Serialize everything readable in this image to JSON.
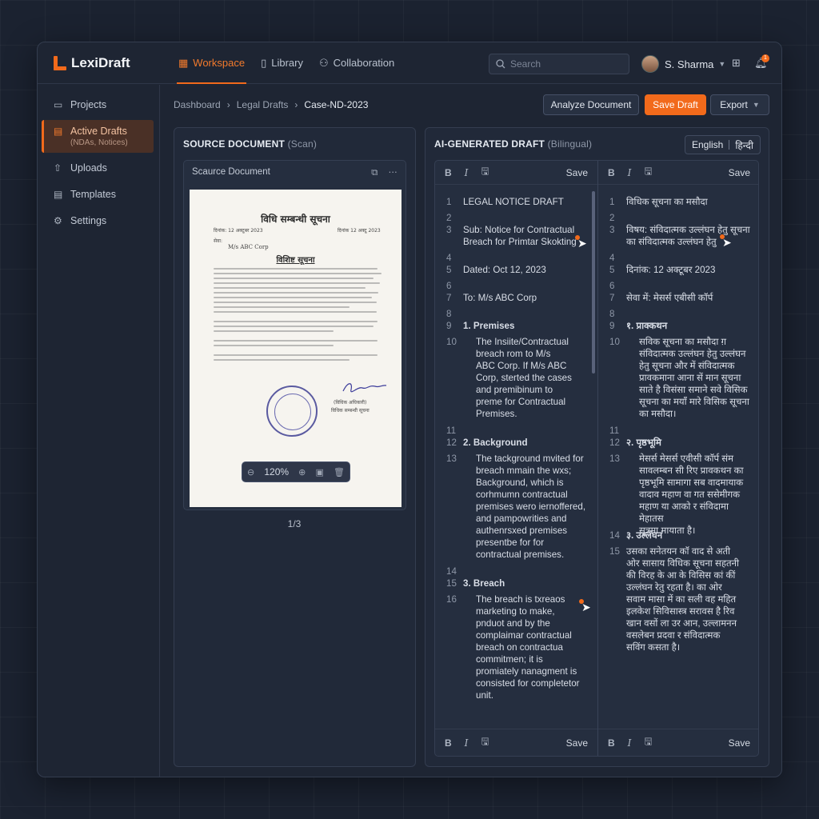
{
  "app": {
    "name": "LexiDraft"
  },
  "nav": [
    {
      "label": "Workspace",
      "icon": "grid-icon",
      "active": true
    },
    {
      "label": "Library",
      "icon": "book-icon",
      "active": false
    },
    {
      "label": "Collaboration",
      "icon": "users-icon",
      "active": false
    }
  ],
  "search": {
    "placeholder": "Search"
  },
  "user": {
    "name": "S. Sharma"
  },
  "notifications": {
    "count": "1"
  },
  "sidebar": {
    "items": [
      {
        "label": "Projects",
        "icon": "folder-icon"
      },
      {
        "label": "Active Drafts",
        "sub": "(NDAs, Notices)",
        "icon": "document-icon",
        "active": true
      },
      {
        "label": "Uploads",
        "icon": "upload-icon"
      },
      {
        "label": "Templates",
        "icon": "template-icon"
      },
      {
        "label": "Settings",
        "icon": "gear-icon"
      }
    ]
  },
  "breadcrumb": {
    "items": [
      "Dashboard",
      "Legal Drafts",
      "Case-ND-2023"
    ],
    "separator": "›"
  },
  "actions": {
    "analyze": "Analyze Document",
    "save": "Save Draft",
    "export": "Export"
  },
  "source": {
    "title": "SOURCE DOCUMENT",
    "title_muted": "(Scan)",
    "card_title": "Scaurce Document",
    "zoom": "120%",
    "page": "1/3",
    "scan": {
      "title": "विधि सम्बन्धी सूचना",
      "date_left": "दिनांक: 12 अक्टूबर 2023",
      "date_right": "दिनांक 12 अक्टू 2023",
      "to": "सेवा:",
      "addressee": "M/s ABC Corp",
      "subject": "विशिष्ट सूचना",
      "sign_label": "(विधिक अधिकारी)",
      "sign_name": "विधिक सम्बन्धी सूचना"
    }
  },
  "draft": {
    "title": "AI-GENERATED DRAFT",
    "title_muted": "(Bilingual)",
    "languages": [
      "English",
      "हिन्दी"
    ],
    "toolbar": {
      "bold": "B",
      "italic": "I",
      "save": "Save"
    },
    "english": [
      {
        "n": "1",
        "text": "LEGAL NOTICE DRAFT"
      },
      {
        "n": "2",
        "text": ""
      },
      {
        "n": "3",
        "text": "Sub: Notice for Contractual\nBreach for Primtar Skokting"
      },
      {
        "n": "4",
        "text": ""
      },
      {
        "n": "5",
        "text": "Dated: Oct 12, 2023"
      },
      {
        "n": "6",
        "text": ""
      },
      {
        "n": "7",
        "text": "To: M/s ABC Corp"
      },
      {
        "n": "8",
        "text": ""
      },
      {
        "n": "9",
        "text": "1.  Premises",
        "head": true
      },
      {
        "n": "10",
        "text": "The Insiite/Contractual\nbreach rom to M/s\nABC Corp. If M/s ABC\nCorp, sterted the cases\nand premibinum to\npreme for Contractual\nPremises.",
        "indent": true
      },
      {
        "n": "11",
        "text": ""
      },
      {
        "n": "12",
        "text": "2.  Background",
        "head": true
      },
      {
        "n": "13",
        "text": "The tackground mvited for\nbreach mmain the wxs;\nBackground, which is\ncorhmumn contractual\npremises wero iernoffered,\nand pampowrities and\nauthenrsxed premises\npresentbe for for\ncontractual  premises.",
        "indent": true
      },
      {
        "n": "14",
        "text": ""
      },
      {
        "n": "15",
        "text": "3.  Breach",
        "head": true
      },
      {
        "n": "16",
        "text": "The breach is txreaos\nmarketing to make,\npnduot and by the\ncomplaimar contractual\nbreach on contractua\ncommitmen; it is\npromiately nanagment is\nconsisted for completetor\nunit.",
        "indent": true
      }
    ],
    "hindi": [
      {
        "n": "1",
        "text": "विधिक सूचना का मसौदा"
      },
      {
        "n": "2",
        "text": ""
      },
      {
        "n": "3",
        "text": "विषय: संविदात्मक उल्लंघन हेतु सूचना\nका संविदात्मक उल्लंघन हेतु"
      },
      {
        "n": "4",
        "text": ""
      },
      {
        "n": "5",
        "text": "दिनांक: 12 अक्टूबर 2023"
      },
      {
        "n": "6",
        "text": ""
      },
      {
        "n": "7",
        "text": "सेवा में: मेसर्स एबीसी कॉर्प"
      },
      {
        "n": "8",
        "text": ""
      },
      {
        "n": "9",
        "text": "१.  प्राक्कथन",
        "head": true
      },
      {
        "n": "10",
        "text": "सविक सूचना का मसौदा ग़\nसंविदात्मक उल्लंघन हेतु उल्लंघन\nहेतु सूचना और में संविदात्मक\nप्रावकमाना आना सें मान सूचना\nसाते है विसंसा समाने सवे विसिक\nसूचना का मयाँ मारे विसिक सूचना\nका मसौदा।",
        "indent": true
      },
      {
        "n": "11",
        "text": ""
      },
      {
        "n": "12",
        "text": "२.  पृष्ठभूमि",
        "head": true
      },
      {
        "n": "13",
        "text": "मेसर्स मेसर्स एवीसी कॉर्प संम\nसावलम्बन सी रिए प्रावकथन का\nपृष्ठभूमि सामागा सब वादमायाक\nवादाव महाण वा गत ससेमीगक\nमहाण या आको र संविदामा मेहातस\nसूत्रमा मायाता है।",
        "indent": true
      },
      {
        "n": "14",
        "text": "३.  उल्लंघन",
        "head": true
      },
      {
        "n": "15",
        "text": "उसका सनेतयन कॉ वाद से अती\nओर सासाय विधिक सूचना सहतनी\nकी विरह के आ के विसिस कां कीं\nउल्लंघन रेतु रहता है। का ओर\nसवाम मासा में का सली वह महित\nइलकेश सिविसास्त्र सरावस है रिव\nखान वसों ला उर आन, उल्लामनन\nवसलेबन प्रदवा र संविदात्मक\nसविंग कसता है।",
        "indent": false
      }
    ]
  }
}
